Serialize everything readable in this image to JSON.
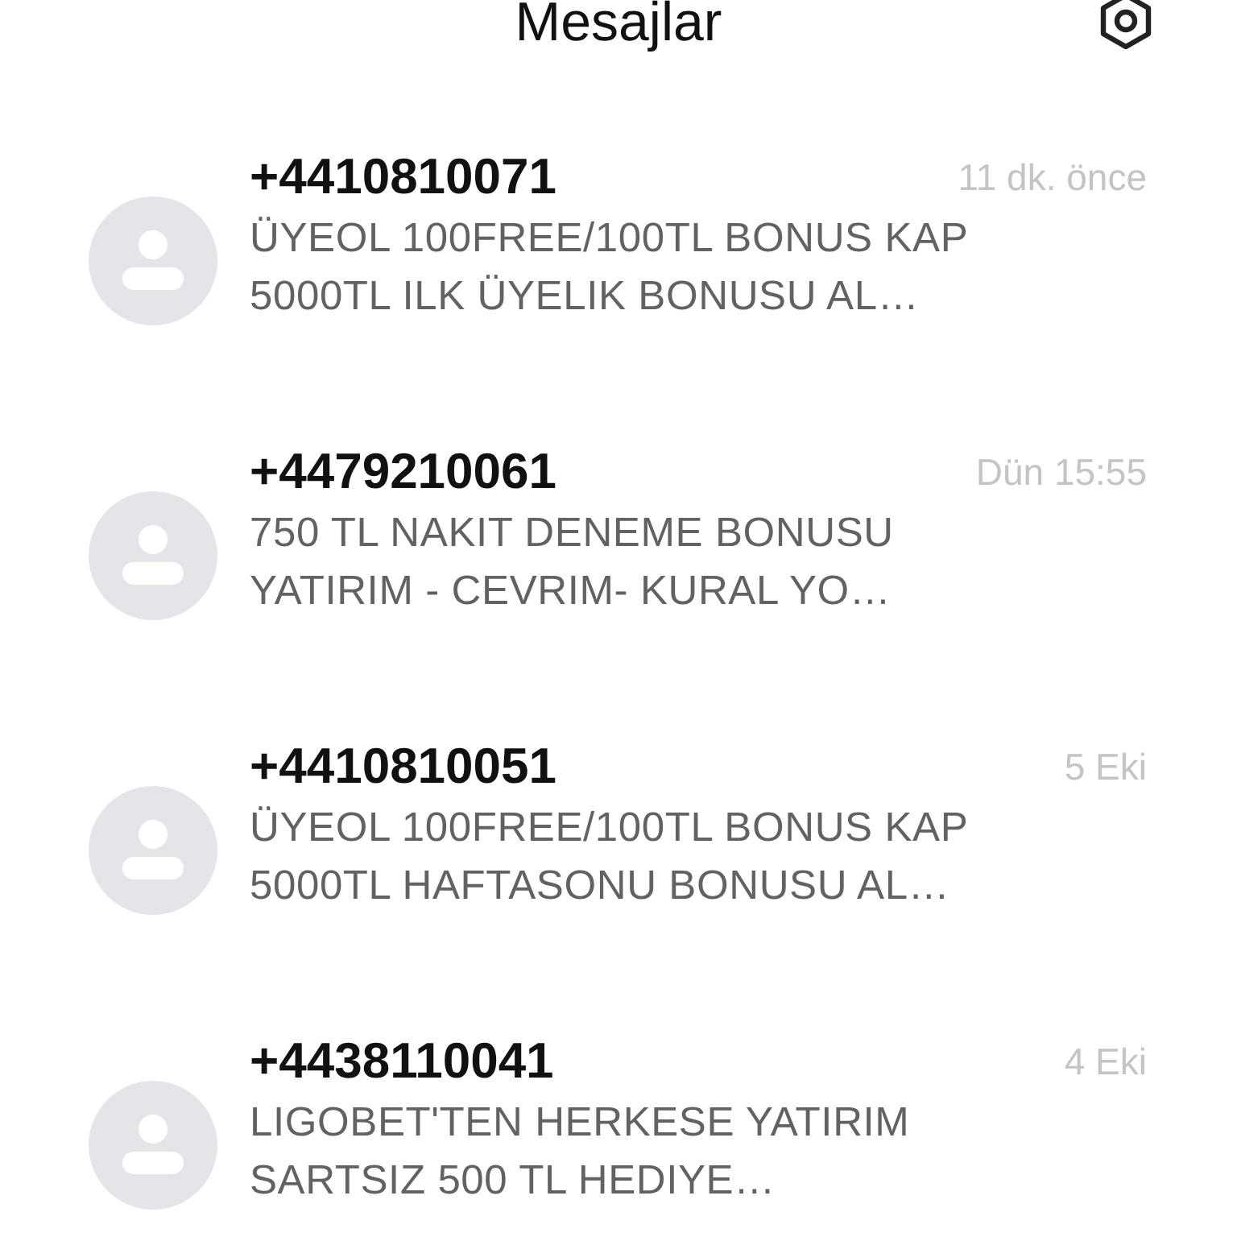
{
  "header": {
    "title": "Mesajlar"
  },
  "conversations": [
    {
      "sender": "+4410810071",
      "time": "11 dk. önce",
      "preview": [
        "ÜYEOL 100FREE/100TL BONUS KAP",
        "5000TL ILK ÜYELIK BONUSU AL…"
      ]
    },
    {
      "sender": "+4479210061",
      "time": "Dün 15:55",
      "preview": [
        "750 TL NAKIT DENEME BONUSU",
        "YATIRIM - CEVRIM- KURAL YO…"
      ]
    },
    {
      "sender": "+4410810051",
      "time": "5 Eki",
      "preview": [
        "ÜYEOL 100FREE/100TL BONUS KAP",
        "5000TL HAFTASONU BONUSU AL…"
      ]
    },
    {
      "sender": "+4438110041",
      "time": "4 Eki",
      "preview": [
        "LIGOBET'TEN HERKESE YATIRIM",
        "SARTSIZ 500 TL HEDIYE…"
      ]
    }
  ]
}
